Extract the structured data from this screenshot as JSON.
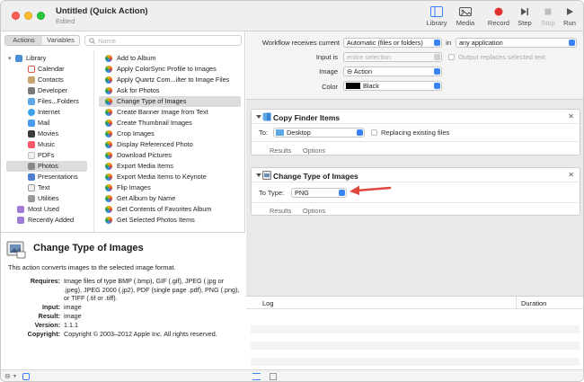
{
  "window": {
    "title": "Untitled (Quick Action)",
    "subtitle": "Edited"
  },
  "toolbar": {
    "library": "Library",
    "media": "Media",
    "record": "Record",
    "step": "Step",
    "stop": "Stop",
    "run": "Run"
  },
  "left": {
    "tabs": [
      "Actions",
      "Variables"
    ],
    "search_placeholder": "Name",
    "library_tree": [
      "Library",
      "Calendar",
      "Contacts",
      "Developer",
      "Files...Folders",
      "Internet",
      "Mail",
      "Movies",
      "Music",
      "PDFs",
      "Photos",
      "Presentations",
      "Text",
      "Utilities",
      "Most Used",
      "Recently Added"
    ],
    "selected_library": "Photos",
    "actions": [
      "Add to Album",
      "Apply ColorSync Profile to Images",
      "Apply Quartz Com...ilter to Image Files",
      "Ask for Photos",
      "Change Type of Images",
      "Create Banner Image from Text",
      "Create Thumbnail Images",
      "Crop Images",
      "Display Referenced Photo",
      "Download Pictures",
      "Export Media Items",
      "Export Media Items to Keynote",
      "Flip Images",
      "Get Album by Name",
      "Get Contents of Favorites Album",
      "Get Selected Photos Items"
    ],
    "selected_action": "Change Type of Images"
  },
  "description": {
    "title": "Change Type of Images",
    "summary": "This action converts images to the selected image format.",
    "requires_label": "Requires:",
    "requires": "Image files of type BMP (.bmp), GIF (.gif), JPEG (.jpg or .jpeg), JPEG 2000 (.jp2), PDF (single page .pdf), PNG (.png), or TIFF (.tif or .tiff).",
    "input_label": "Input:",
    "input": "image",
    "result_label": "Result:",
    "result": "image",
    "version_label": "Version:",
    "version": "1.1.1",
    "copyright_label": "Copyright:",
    "copyright": "Copyright © 2003–2012 Apple Inc.  All rights reserved."
  },
  "workflow": {
    "receives_label": "Workflow receives current",
    "receives_value": "Automatic (files or folders)",
    "in_label": "in",
    "in_value": "any application",
    "input_is_label": "Input is",
    "input_is_value": "entire selection",
    "output_replaces": "Output replaces selected text",
    "image_label": "Image",
    "image_value": "⊖ Action",
    "color_label": "Color",
    "color_value": "Black"
  },
  "card1": {
    "title": "Copy Finder Items",
    "to_label": "To:",
    "to_value": "Desktop",
    "replacing": "Replacing existing files",
    "results": "Results",
    "options": "Options"
  },
  "card2": {
    "title": "Change Type of Images",
    "to_type_label": "To Type:",
    "to_type_value": "PNG",
    "results": "Results",
    "options": "Options"
  },
  "log": {
    "col_log": "Log",
    "col_duration": "Duration"
  },
  "colors": {
    "accent": "#3b82f6",
    "arrow": "#e0483d",
    "selection": "#dcdcdc"
  }
}
